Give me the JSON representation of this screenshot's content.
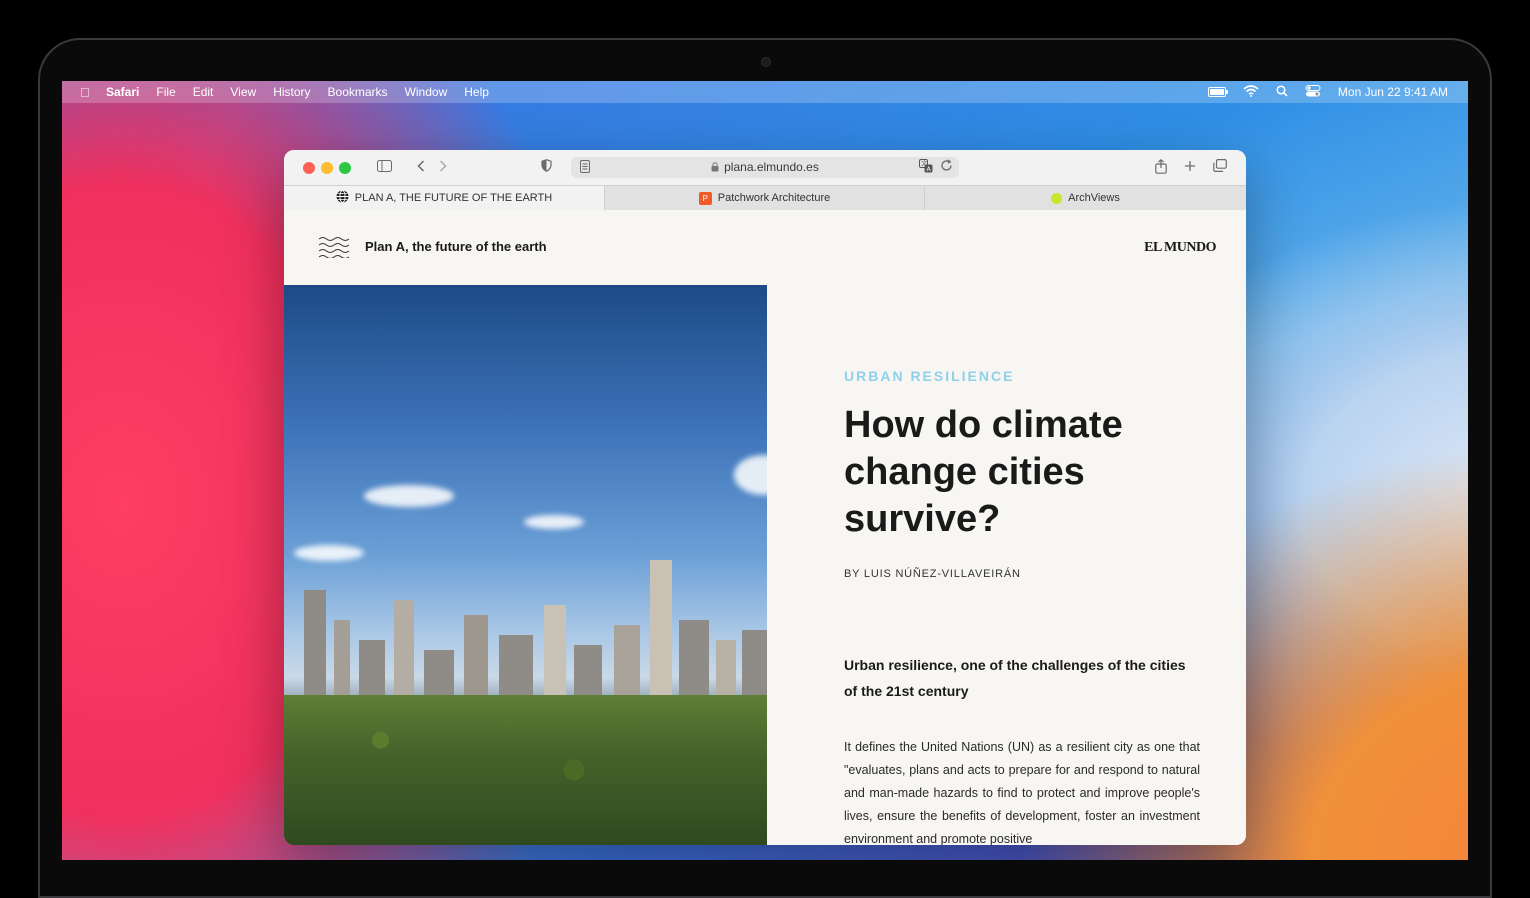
{
  "menubar": {
    "app_name": "Safari",
    "items": [
      "File",
      "Edit",
      "View",
      "History",
      "Bookmarks",
      "Window",
      "Help"
    ],
    "clock": "Mon Jun 22  9:41 AM"
  },
  "browser": {
    "url": "plana.elmundo.es",
    "tabs": [
      {
        "label": "PLAN A, THE FUTURE OF THE EARTH",
        "icon": "globe-icon"
      },
      {
        "label": "Patchwork Architecture",
        "icon": "p-badge-icon",
        "badge": "P"
      },
      {
        "label": "ArchViews",
        "icon": "green-dot-icon"
      }
    ]
  },
  "site": {
    "title": "Plan A, the future of the earth",
    "logo": "EL MUNDO"
  },
  "article": {
    "kicker": "URBAN RESILIENCE",
    "headline": "How do climate change cities survive?",
    "byline": "BY LUIS NÚÑEZ-VILLAVEIRÁN",
    "lead": "Urban resilience, one of the challenges of the cities of the 21st century",
    "body": "It defines the United Nations (UN) as a resilient city as one that \"evaluates, plans and acts to prepare for and respond to natural and man-made hazards to find to protect and improve people's lives, ensure the benefits of development, foster an investment environment and promote positive"
  },
  "colors": {
    "kicker": "#8fd0ea",
    "close": "#ff5f57",
    "minimize": "#febc2e",
    "zoom": "#28c840",
    "patchwork_badge": "#f05a28",
    "archviews_dot": "#c8e62a"
  }
}
